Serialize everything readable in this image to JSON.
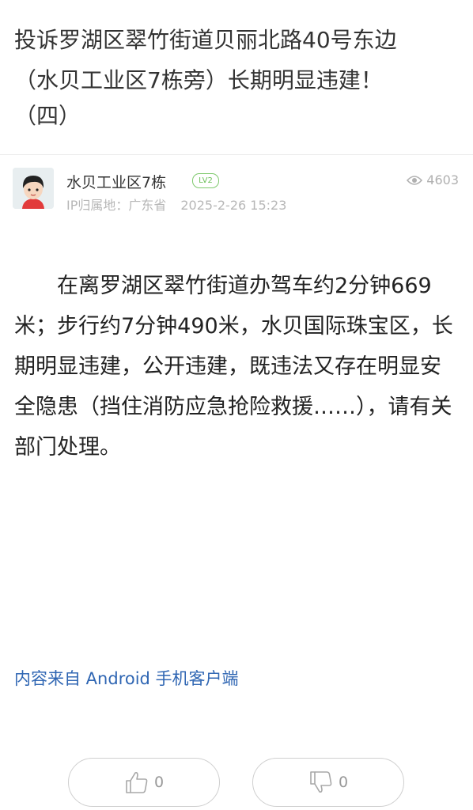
{
  "post": {
    "title_lines": [
      "投诉罗湖区翠竹街道贝丽北路40号东边",
      "（水贝工业区7栋旁）长期明显违建！",
      "（四）"
    ],
    "author": {
      "name": "水贝工业区7栋",
      "level": "LV2",
      "ip_location": "IP归属地：广东省",
      "date": "2025-2-26 15:23"
    },
    "views": "4603",
    "content": "在离罗湖区翠竹街道办驾车约2分钟669米；步行约7分钟490米，水贝国际珠宝区，长期明显违建，公开违建，既违法又存在明显安全隐患（挡住消防应急抢险救援……），请有关部门处理。",
    "source": "内容来自 Android 手机客户端"
  },
  "actions": {
    "like_count": "0",
    "dislike_count": "0"
  },
  "colors": {
    "link_blue": "#2f66b3",
    "badge_green": "#6cbf59",
    "muted_gray": "#b7b7b7"
  },
  "icons": {
    "views": "eye-icon",
    "like": "thumbs-up-icon",
    "dislike": "thumbs-down-icon"
  }
}
